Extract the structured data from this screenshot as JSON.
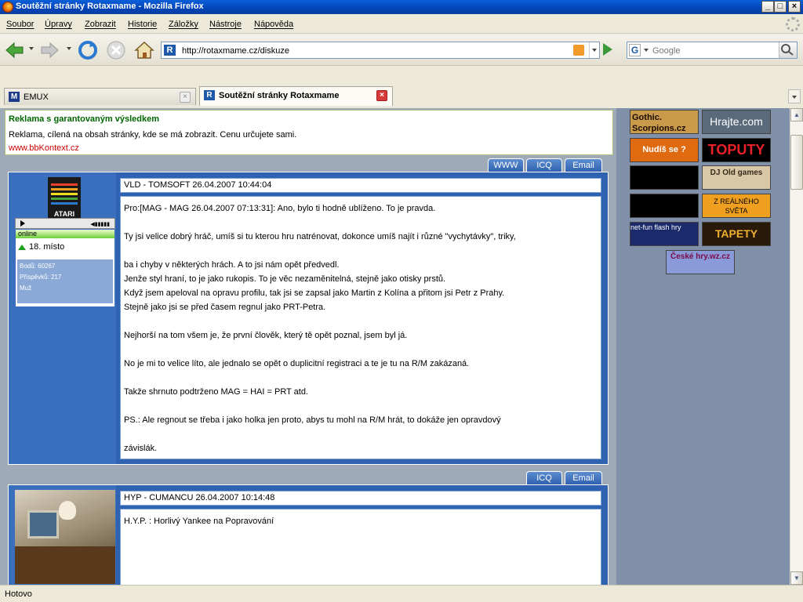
{
  "window": {
    "title": "Soutěžní stránky Rotaxmame - Mozilla Firefox"
  },
  "menu": [
    "Soubor",
    "Úpravy",
    "Zobrazit",
    "Historie",
    "Záložky",
    "Nástroje",
    "Nápověda"
  ],
  "nav": {
    "url": "http://rotaxmame.cz/diskuze",
    "search_placeholder": "Google",
    "search_engine": "G"
  },
  "tabs": [
    {
      "label": "EMUX",
      "icon": "M",
      "active": false
    },
    {
      "label": "Soutěžní stránky Rotaxmame",
      "icon": "R",
      "active": true
    }
  ],
  "ad": {
    "headline": "Reklama s garantovaným výsledkem",
    "description": "Reklama, cílená na obsah stránky, kde se má zobrazit. Cenu určujete sami.",
    "url": "www.bbKontext.cz"
  },
  "post1": {
    "tabs": [
      "WWW",
      "ICQ",
      "Email"
    ],
    "avatar_label": "ATARI",
    "online": "online",
    "rank": "18. místo",
    "stats": [
      "Bodů: 60267",
      "Příspěvků: 217",
      "Muž"
    ],
    "header": "VLD - TOMSOFT 26.04.2007 10:44:04",
    "lines": [
      "Pro:[MAG - MAG 26.04.2007 07:13:31]: Ano, bylo ti hodně ublíženo. To je pravda.",
      "",
      "Ty jsi velice dobrý hráč, umíš si tu kterou hru natrénovat, dokonce umíš najít i různé \"vychytávky\", triky,",
      "",
      "ba i chyby v některých hrách. A to jsi nám opět předvedl.",
      "Jenže styl hraní, to je jako rukopis. To je věc nezaměnitelná, stejně jako otisky prstů.",
      "Když jsem apeloval na opravu profilu, tak jsi se zapsal jako Martin z Kolína a přitom jsi Petr z Prahy.",
      "Stejně jako jsi se před časem regnul jako PRT-Petra.",
      "",
      "Nejhorší na tom všem je, že první člověk, který tě opět poznal, jsem byl já.",
      "",
      "No je mi to velice líto, ale jednalo se opět o duplicitní registraci a te je tu na R/M zakázaná.",
      "",
      "Takže shrnuto podtrženo MAG = HAI = PRT atd.",
      "",
      "PS.: Ale regnout se třeba i jako holka jen proto, abys tu mohl na R/M hrát, to dokáže jen opravdový",
      "",
      "závislák."
    ]
  },
  "post2": {
    "tabs": [
      "ICQ",
      "Email"
    ],
    "header": "HYP - CUMANCU 26.04.2007 10:14:48",
    "lines": [
      "H.Y.P. : Horlivý Yankee na Popravování"
    ]
  },
  "banners": [
    {
      "text": "Gothic. Scorpions.cz",
      "bg": "#c89a4a"
    },
    {
      "text": "Hrajte.com",
      "bg": "#5a6a7a"
    },
    {
      "text": "Nudíš se ?",
      "bg": "#e06a10"
    },
    {
      "text": "TOPUTY",
      "bg": "#000000"
    },
    {
      "text": "",
      "bg": "#000000"
    },
    {
      "text": "DJ Old games",
      "bg": "#d8c8a8"
    },
    {
      "text": "",
      "bg": "#000000"
    },
    {
      "text": "Z REÁLNÉHO SVĚTA",
      "bg": "#f0a020"
    },
    {
      "text": "net-fun flash hry",
      "bg": "#1a2a6a"
    },
    {
      "text": "TAPETY",
      "bg": "#2a1a0a"
    },
    {
      "text": "České hry.wz.cz",
      "bg": "#5a4a9a"
    }
  ],
  "status": "Hotovo"
}
